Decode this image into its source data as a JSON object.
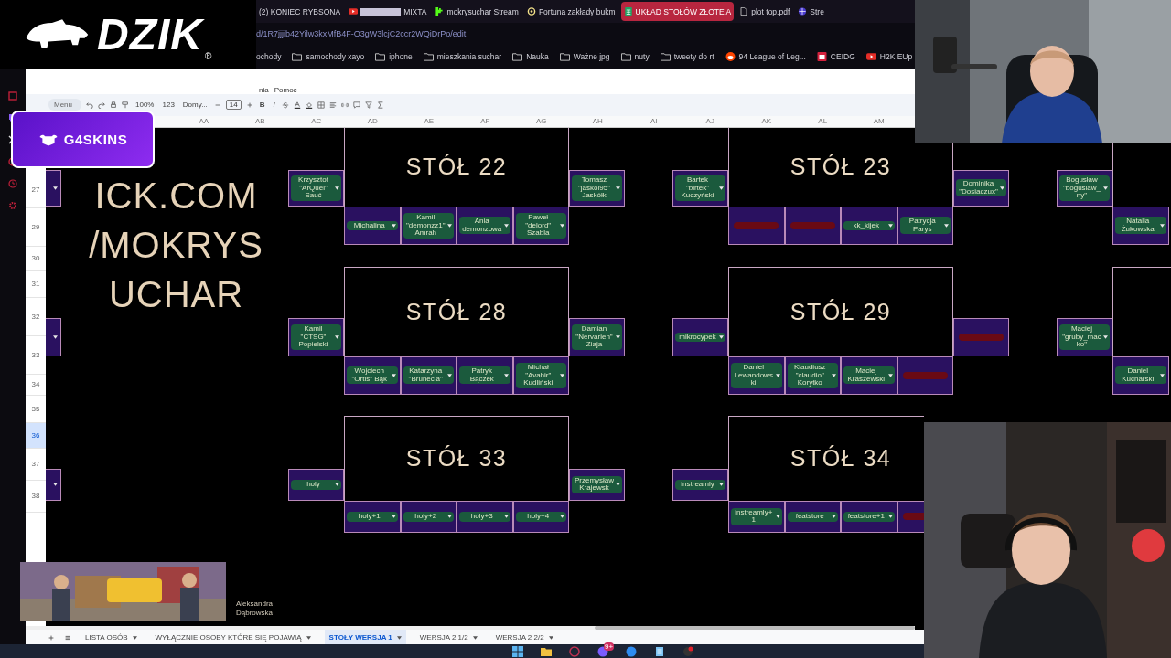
{
  "logo": {
    "text": "DZIK",
    "mark": "®"
  },
  "sponsor": "G4SKINS",
  "browser": {
    "tabs": [
      {
        "title": "(2) KONIEC RYBSONA",
        "kind": "plain",
        "redacted": false,
        "selected": false
      },
      {
        "title": "MIXTA",
        "kind": "video",
        "redacted": true,
        "selected": false
      },
      {
        "title": "mokrysuchar Stream",
        "kind": "stream",
        "redacted": false,
        "selected": false
      },
      {
        "title": "Fortuna zakłady bukm",
        "kind": "ring",
        "redacted": false,
        "selected": false
      },
      {
        "title": "UKŁAD STOŁÓW ZŁOTE A",
        "kind": "sheet",
        "redacted": false,
        "selected": true
      },
      {
        "title": "plot top.pdf",
        "kind": "file",
        "redacted": false,
        "selected": false
      },
      {
        "title": "Stre",
        "kind": "globe",
        "redacted": false,
        "selected": false
      }
    ],
    "address": "d/1R7jjjib42Yilw3kxMfB4F-O3gW3lcjC2ccr2WQiDrPo/edit",
    "bookmarks": [
      {
        "label": "ochody",
        "kind": "plain"
      },
      {
        "label": "samochody xayo",
        "kind": "folder"
      },
      {
        "label": "iphone",
        "kind": "folder"
      },
      {
        "label": "mieszkania suchar",
        "kind": "folder"
      },
      {
        "label": "Nauka",
        "kind": "folder"
      },
      {
        "label": "Ważne jpg",
        "kind": "folder"
      },
      {
        "label": "nuty",
        "kind": "folder"
      },
      {
        "label": "tweety do rt",
        "kind": "folder"
      },
      {
        "label": "94 League of Leg...",
        "kind": "forum"
      },
      {
        "label": "CEIDG",
        "kind": "emblem"
      },
      {
        "label": "H2K EUp",
        "kind": "video"
      }
    ]
  },
  "sheet": {
    "menu": [
      "nia",
      "Pomoc"
    ],
    "toolbar": {
      "search_placeholder": "Menu",
      "zoom": "100%",
      "format": "123",
      "font": "Domy...",
      "font_size": "14",
      "bold": "B",
      "italic": "I"
    },
    "columns": [
      "AA",
      "AB",
      "AC",
      "AD",
      "AE",
      "AF",
      "AG",
      "AH",
      "AI",
      "AJ",
      "AK",
      "AL",
      "AM"
    ],
    "row_numbers": [
      {
        "label": "27",
        "selected": false
      },
      {
        "label": "29",
        "selected": false
      },
      {
        "label": "30",
        "selected": false
      },
      {
        "label": "31",
        "selected": false
      },
      {
        "label": "32",
        "selected": false
      },
      {
        "label": "33",
        "selected": false
      },
      {
        "label": "34",
        "selected": false
      },
      {
        "label": "35",
        "selected": false
      },
      {
        "label": "36",
        "selected": true
      },
      {
        "label": "37",
        "selected": false
      },
      {
        "label": "38",
        "selected": false
      }
    ],
    "side_text": "ICK.COM /MOKRYS UCHAR",
    "rows": [
      {
        "tables": [
          {
            "title": "STÓŁ 22",
            "left": {
              "kind": "person",
              "name": "Krzysztof \"ArQuel\" Sauć"
            },
            "right": {
              "kind": "person",
              "name": "Tomasz \"jaskol95\" Jaskółk"
            },
            "bottom": [
              {
                "kind": "person",
                "name": "Michalina"
              },
              {
                "kind": "person",
                "name": "Kamil \"demonzz1\" Amrah"
              },
              {
                "kind": "person",
                "name": "Ania demonzowa"
              },
              {
                "kind": "person",
                "name": "Paweł \"delord\" Szabla"
              }
            ]
          },
          {
            "title": "STÓŁ 23",
            "left": {
              "kind": "person",
              "name": "Bartek \"birtek\" Kuczyński"
            },
            "right": {
              "kind": "person",
              "name": "Dominika \"Dosiaczux\""
            },
            "bottom": [
              {
                "kind": "empty"
              },
              {
                "kind": "empty"
              },
              {
                "kind": "person",
                "name": "kk_kijek"
              },
              {
                "kind": "person",
                "name": "Patrycja Parys"
              }
            ]
          },
          {
            "left": {
              "kind": "person",
              "name": "Bogusław \"boguslaw_ny\""
            },
            "bottom": [
              {
                "kind": "person",
                "name": "Natalia Żukowska"
              }
            ]
          }
        ]
      },
      {
        "tables": [
          {
            "title": "STÓŁ 28",
            "left": {
              "kind": "person",
              "name": "Kamil \"CTSG\" Popielski"
            },
            "right": {
              "kind": "person",
              "name": "Damian \"Nervarien\" Ziaja"
            },
            "bottom": [
              {
                "kind": "person",
                "name": "Wojciech \"Ortis\" Bąk"
              },
              {
                "kind": "person",
                "name": "Katarzyna \"Brunecia\""
              },
              {
                "kind": "person",
                "name": "Patryk Bączek"
              },
              {
                "kind": "person",
                "name": "Michał \"Avahir\" Kudliński"
              }
            ]
          },
          {
            "title": "STÓŁ 29",
            "left": {
              "kind": "person",
              "name": "mikrocypek"
            },
            "right": {
              "kind": "empty"
            },
            "bottom": [
              {
                "kind": "person",
                "name": "Daniel Lewandowski"
              },
              {
                "kind": "person",
                "name": "Klaudiusz \"claudio\" Korytko"
              },
              {
                "kind": "person",
                "name": "Maciej Kraszewski"
              },
              {
                "kind": "empty"
              }
            ]
          },
          {
            "left": {
              "kind": "person",
              "name": "Maciej \"gruby_macko\""
            },
            "bottom": [
              {
                "kind": "person",
                "name": "Daniel Kucharski"
              }
            ]
          }
        ]
      },
      {
        "tables": [
          {
            "title": "STÓŁ 33",
            "left": {
              "kind": "person",
              "name": "holy"
            },
            "right": {
              "kind": "person",
              "name": "Przemysław Krajewsk"
            },
            "bottom": [
              {
                "kind": "person",
                "name": "holy+1"
              },
              {
                "kind": "person",
                "name": "holy+2"
              },
              {
                "kind": "person",
                "name": "holy+3"
              },
              {
                "kind": "person",
                "name": "holy+4"
              }
            ]
          },
          {
            "title": "STÓŁ 34",
            "left": {
              "kind": "person",
              "name": "instreamly"
            },
            "bottom": [
              {
                "kind": "person",
                "name": "instreamly+1"
              },
              {
                "kind": "person",
                "name": "featstore"
              },
              {
                "kind": "person",
                "name": "featstore+1"
              },
              {
                "kind": "empty"
              }
            ]
          }
        ]
      }
    ],
    "tabs": [
      {
        "label": "LISTA OSÓB",
        "selected": false
      },
      {
        "label": "WYŁĄCZNIE OSOBY KTÓRE SIĘ POJAWIĄ",
        "selected": false
      },
      {
        "label": "STOŁY WERSJA 1",
        "selected": true
      },
      {
        "label": "WERSJA 2 1/2",
        "selected": false
      },
      {
        "label": "WERSJA 2 2/2",
        "selected": false
      }
    ]
  },
  "overlay_caption": "Aleksandra Dąbrowska",
  "taskbar": {
    "badge": "9+"
  }
}
